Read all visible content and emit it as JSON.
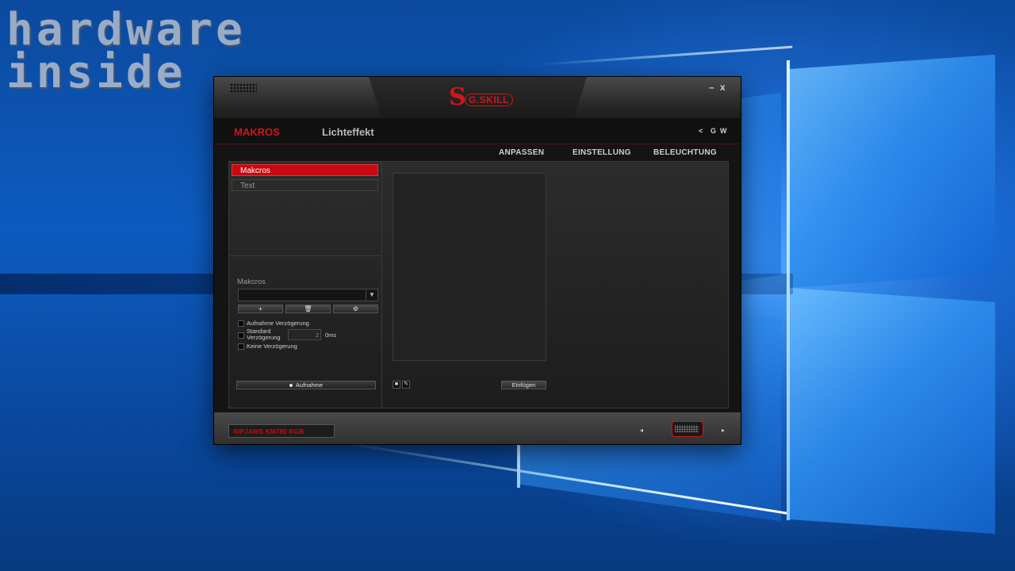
{
  "watermark": {
    "line1": "hardware",
    "line2": "inside"
  },
  "titlebar": {
    "brand": "G.SKILL",
    "minimize": "–",
    "close": "x"
  },
  "nav": {
    "tabs": [
      {
        "label": "MAKROS"
      },
      {
        "label": "Lichteffekt"
      }
    ],
    "icons": {
      "share": "<",
      "g": "G",
      "w": "W"
    }
  },
  "subnav": {
    "items": [
      {
        "label": "ANPASSEN"
      },
      {
        "label": "EINSTELLUNG"
      },
      {
        "label": "BELEUCHTUNG"
      }
    ]
  },
  "macro_list": {
    "items": [
      {
        "label": "Makcros"
      },
      {
        "label": "Text"
      }
    ]
  },
  "macro_settings": {
    "section_label": "Makcros",
    "select_value": "",
    "buttons": {
      "add": "+",
      "delete": "🗑",
      "settings": "⚙"
    },
    "options": [
      {
        "label": "Aufnahme Verzögerung"
      },
      {
        "label": "Standard Verzögerung"
      },
      {
        "label": "Keine Verzögerung"
      }
    ],
    "delay_value": "2",
    "delay_unit": "0ms",
    "record_label": "Aufnahme"
  },
  "editor": {
    "insert_label": "Einfügen"
  },
  "footer": {
    "model": "RIPJAWS KM780 RGB",
    "prev": "◂",
    "next": "▸"
  }
}
